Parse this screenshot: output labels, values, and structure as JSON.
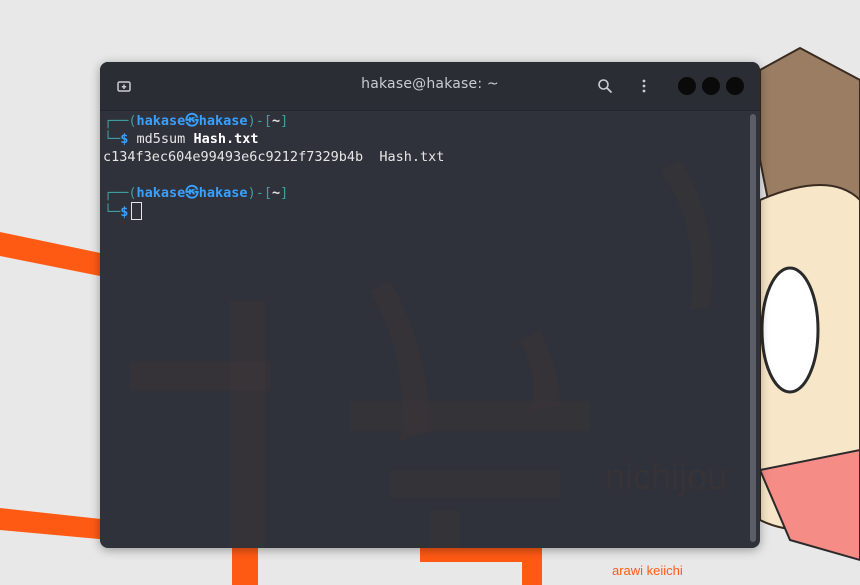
{
  "wallpaper": {
    "art_text": "nichijou",
    "art_credit": "arawi keiichi"
  },
  "window": {
    "title": "hakase@hakase: ~",
    "new_tab_icon": "new-tab-icon",
    "search_icon": "search-icon",
    "menu_icon": "kebab-menu-icon"
  },
  "terminal": {
    "prompt1": {
      "frame_top": "┌──(",
      "user": "hakase㉿hakase",
      "bracket_mid": ")-[",
      "path": "~",
      "bracket_end": "]",
      "frame_bottom": "└─",
      "dollar": "$ ",
      "command": "md5sum ",
      "argument": "Hash.txt"
    },
    "output": "c134f3ec604e99493e6c9212f7329b4b  Hash.txt",
    "prompt2": {
      "frame_top": "┌──(",
      "user": "hakase㉿hakase",
      "bracket_mid": ")-[",
      "path": "~",
      "bracket_end": "]",
      "frame_bottom": "└─",
      "dollar": "$"
    }
  },
  "colors": {
    "terminal_bg": "#2f323a",
    "frame": "#3f9f9f",
    "user": "#3aa0ff",
    "text": "#e6e6e6",
    "wallpaper_orange": "#ff5a14"
  }
}
